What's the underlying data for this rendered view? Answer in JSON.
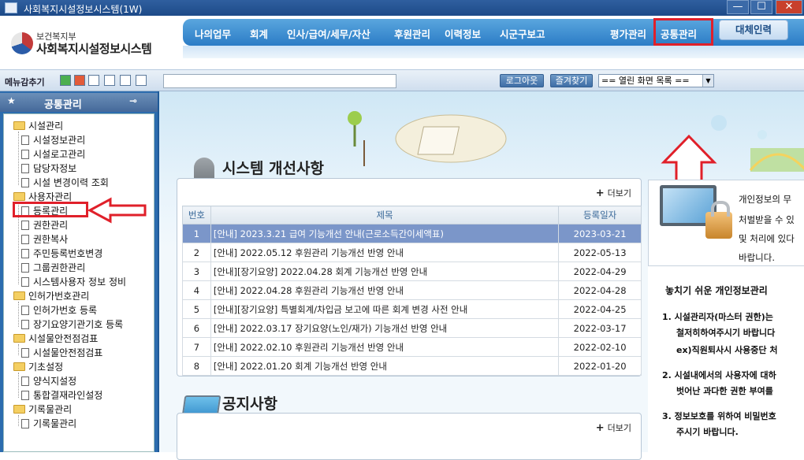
{
  "window": {
    "title": "사회복지시설정보시스템(1W)",
    "min": "—",
    "max": "☐",
    "close": "✕"
  },
  "logo": {
    "sub": "보건복지부",
    "main": "사회복지시설정보시스템"
  },
  "menu": [
    "나의업무",
    "회계",
    "인사/급여/세무/자산",
    "후원관리",
    "이력정보",
    "시군구보고",
    "평가관리",
    "공통관리"
  ],
  "daeche_button": "대체인력",
  "toolbar": {
    "label": "메뉴감추기",
    "logout": "로그아웃",
    "favorites": "즐겨찾기",
    "open_screens": "== 열린 화면 목록 =="
  },
  "sidebar": {
    "title": "공통관리",
    "tree": [
      {
        "type": "folder",
        "label": "시설관리"
      },
      {
        "type": "page",
        "label": "시설정보관리"
      },
      {
        "type": "page",
        "label": "시설로고관리"
      },
      {
        "type": "page",
        "label": "담당자정보"
      },
      {
        "type": "page",
        "label": "시설 변경이력 조회"
      },
      {
        "type": "folder",
        "label": "사용자관리"
      },
      {
        "type": "page",
        "label": "등록관리"
      },
      {
        "type": "page",
        "label": "권한관리"
      },
      {
        "type": "page",
        "label": "권한복사"
      },
      {
        "type": "page",
        "label": "주민등록번호변경"
      },
      {
        "type": "page",
        "label": "그룹권한관리"
      },
      {
        "type": "page",
        "label": "시스템사용자 정보 정비"
      },
      {
        "type": "folder",
        "label": "인허가번호관리"
      },
      {
        "type": "page",
        "label": "인허가번호 등록"
      },
      {
        "type": "page",
        "label": "장기요양기관기호 등록"
      },
      {
        "type": "folder",
        "label": "시설물안전점검표"
      },
      {
        "type": "page",
        "label": "시설물안전점검표"
      },
      {
        "type": "folder",
        "label": "기초설정"
      },
      {
        "type": "page",
        "label": "양식지설정"
      },
      {
        "type": "page",
        "label": "통합결재라인설정"
      },
      {
        "type": "folder",
        "label": "기록물관리"
      },
      {
        "type": "page",
        "label": "기록물관리"
      }
    ]
  },
  "system_notice": {
    "title": "시스템 개선사항",
    "more": "더보기",
    "headers": [
      "번호",
      "제목",
      "등록일자"
    ],
    "rows": [
      {
        "no": "1",
        "title": "[안내] 2023.3.21 급여 기능개선 안내(근로소득간이세액표)",
        "date": "2023-03-21"
      },
      {
        "no": "2",
        "title": "[안내] 2022.05.12 후원관리 기능개선 반영 안내",
        "date": "2022-05-13"
      },
      {
        "no": "3",
        "title": "[안내][장기요양] 2022.04.28 회계 기능개선 반영 안내",
        "date": "2022-04-29"
      },
      {
        "no": "4",
        "title": "[안내] 2022.04.28 후원관리 기능개선 반영 안내",
        "date": "2022-04-28"
      },
      {
        "no": "5",
        "title": "[안내][장기요양] 특별회계/차입금 보고에 따른 회계 변경 사전 안내",
        "date": "2022-04-25"
      },
      {
        "no": "6",
        "title": "[안내] 2022.03.17 장기요양(노인/재가) 기능개선 반영 안내",
        "date": "2022-03-17"
      },
      {
        "no": "7",
        "title": "[안내] 2022.02.10 후원관리 기능개선 반영 안내",
        "date": "2022-02-10"
      },
      {
        "no": "8",
        "title": "[안내] 2022.01.20 회계 기능개선 반영 안내",
        "date": "2022-01-20"
      }
    ]
  },
  "notice": {
    "title": "공지사항",
    "more": "더보기"
  },
  "privacy": {
    "lines": [
      "개인정보의 무",
      "처벌받을 수 있",
      "및 처리에 있다",
      "바랍니다."
    ],
    "heading": "놓치기 쉬운 개인정보관리",
    "items": [
      "1. 시설관리자(마스터 권한)는",
      "철저히하여주시기 바랍니다",
      "ex)직원퇴사시 사용중단 처",
      "2. 시설내에서의 사용자에 대하",
      "벗어난 과다한 권한 부여를",
      "3. 정보보호를 위하여 비밀번호",
      "주시기 바랍니다."
    ]
  }
}
